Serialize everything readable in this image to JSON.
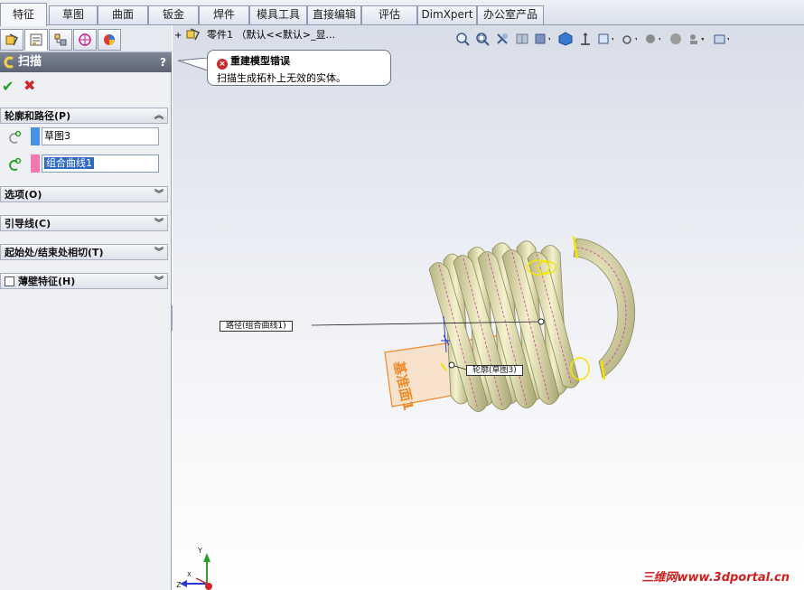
{
  "tabs": [
    {
      "label": "特征",
      "active": true
    },
    {
      "label": "草图"
    },
    {
      "label": "曲面"
    },
    {
      "label": "钣金"
    },
    {
      "label": "焊件"
    },
    {
      "label": "模具工具"
    },
    {
      "label": "直接编辑"
    },
    {
      "label": "评估"
    },
    {
      "label": "DimXpert"
    },
    {
      "label": "办公室产品"
    }
  ],
  "manager_icons": [
    "feature-manager-icon",
    "property-manager-icon",
    "configuration-manager-icon",
    "dimxpert-manager-icon",
    "display-manager-icon"
  ],
  "property_manager": {
    "title": "扫描",
    "help": "?",
    "ok": "✔",
    "cancel": "✖",
    "groups": {
      "profile_path": {
        "label": "轮廓和路径(P)",
        "profile_value": "草图3",
        "path_value": "组合曲线1",
        "profile_color": "#4a90e2",
        "path_color": "#f07ab0"
      },
      "options": {
        "label": "选项(O)"
      },
      "guide_curves": {
        "label": "引导线(C)"
      },
      "tangency": {
        "label": "起始处/结束处相切(T)"
      },
      "thin": {
        "label": "薄壁特征(H)"
      }
    }
  },
  "graphics": {
    "tree_item": "零件1 （默认<<默认>_显...",
    "error_title": "重建模型错误",
    "error_message": "扫描生成拓朴上无效的实体。",
    "path_label": "路径(组合曲线1)",
    "profile_label": "轮廓(草图3)",
    "plane_label": "基准面1",
    "triad": {
      "x": "X",
      "y": "Y",
      "z": "Z"
    },
    "watermark": "三维网www.3dportal.cn"
  },
  "colors": {
    "spring": "#e9e7b8",
    "spring_shadow": "#a9a674",
    "plane": "#f08a2a",
    "edge": "#f2e600",
    "path": "#cc3f9d"
  }
}
